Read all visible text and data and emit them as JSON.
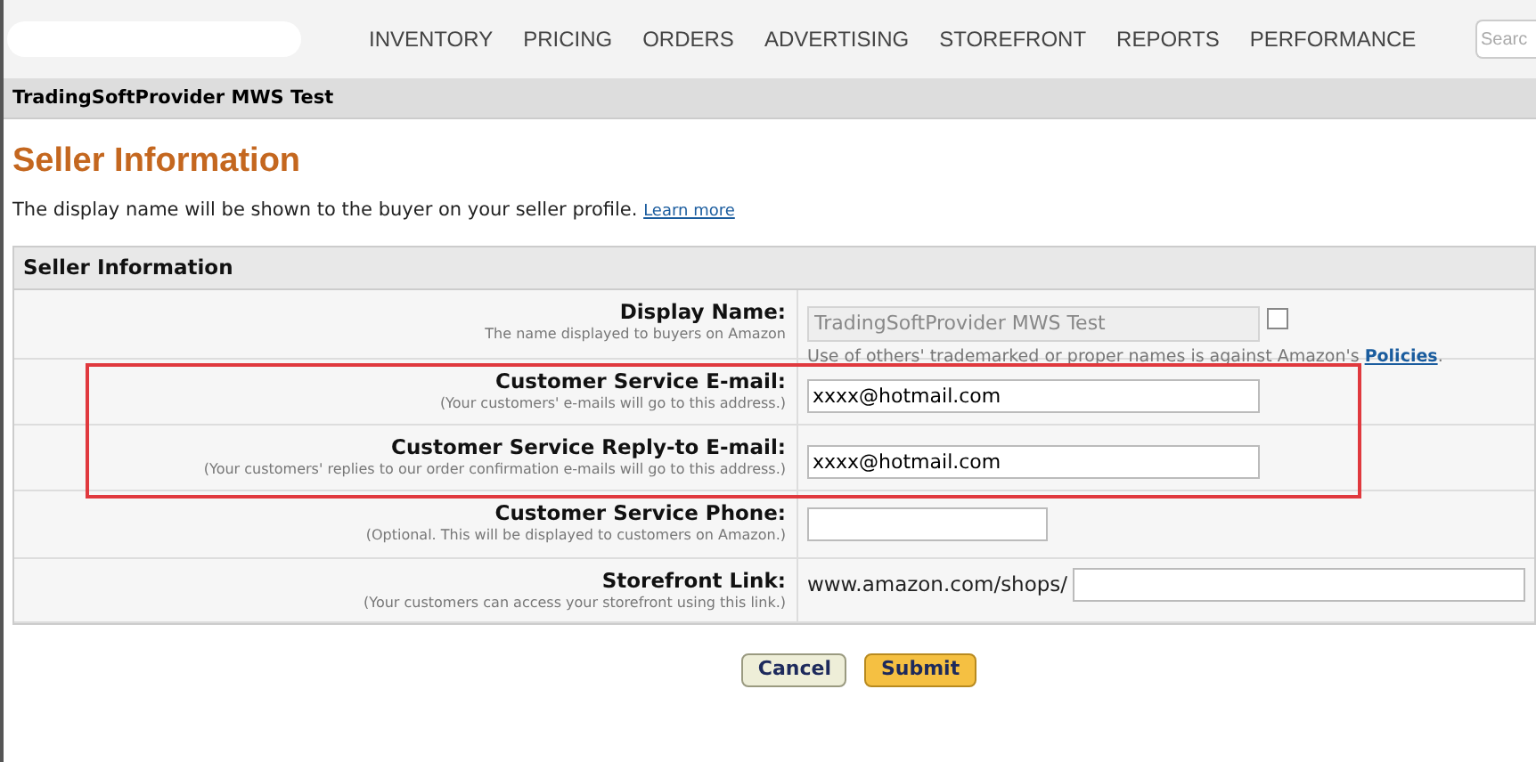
{
  "nav": {
    "items": [
      "INVENTORY",
      "PRICING",
      "ORDERS",
      "ADVERTISING",
      "STOREFRONT",
      "REPORTS",
      "PERFORMANCE"
    ],
    "search": {
      "placeholder": "Searc"
    }
  },
  "account_bar": {
    "name": "TradingSoftProvider MWS Test"
  },
  "heading": "Seller Information",
  "intro": {
    "text": "The display name will be shown to the buyer on your seller profile.",
    "link": "Learn more"
  },
  "panel": {
    "title": "Seller Information",
    "rows": [
      {
        "kind": "display",
        "label": "Display Name:",
        "hint": "The name displayed to buyers on Amazon",
        "value": "TradingSoftProvider MWS Test",
        "disabled": true,
        "checked": false,
        "note": "Use of others' trademarked or proper names is against Amazon's",
        "note_link": "Policies",
        "note_end": ".",
        "highlighted": false
      },
      {
        "kind": "text",
        "label": "Customer Service E-mail:",
        "hint": "(Your customers' e-mails will go to this address.)",
        "value": "xxxx@hotmail.com",
        "highlighted": true
      },
      {
        "kind": "text",
        "label": "Customer Service Reply-to E-mail:",
        "hint": "(Your customers' replies to our order confirmation e-mails will go to this address.)",
        "value": "xxxx@hotmail.com",
        "highlighted": true
      },
      {
        "kind": "short",
        "label": "Customer Service Phone:",
        "hint": "(Optional. This will be displayed to customers on Amazon.)",
        "highlighted": false
      },
      {
        "kind": "prefixed",
        "label": "Storefront Link:",
        "hint": "(Your customers can access your storefront using this link.)",
        "prefix": "www.amazon.com/shops/",
        "highlighted": false
      }
    ]
  },
  "buttons": [
    {
      "kind": "cancel",
      "label": "Cancel"
    },
    {
      "kind": "submit",
      "label": "Submit"
    }
  ]
}
